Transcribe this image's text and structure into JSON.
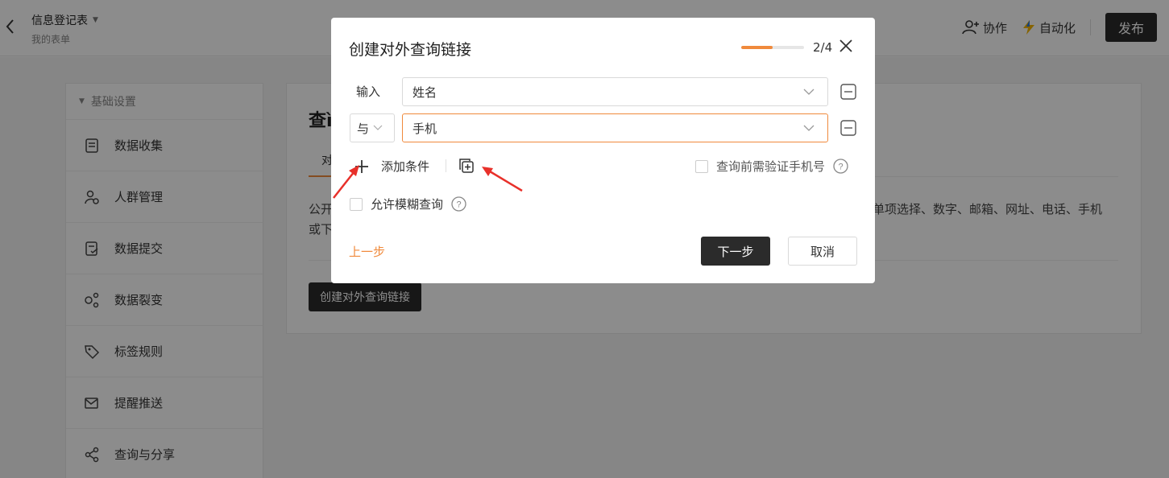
{
  "header": {
    "doc_title": "信息登记表",
    "doc_subtitle": "我的表单",
    "collab_label": "协作",
    "automation_label": "自动化",
    "publish_label": "发布"
  },
  "sidebar": {
    "group_label": "基础设置",
    "items": [
      {
        "label": "数据收集",
        "icon": "document-icon"
      },
      {
        "label": "人群管理",
        "icon": "user-group-icon"
      },
      {
        "label": "数据提交",
        "icon": "submit-icon"
      },
      {
        "label": "数据裂变",
        "icon": "fission-icon"
      },
      {
        "label": "标签规则",
        "icon": "tag-icon"
      },
      {
        "label": "提醒推送",
        "icon": "send-icon"
      },
      {
        "label": "查询与分享",
        "icon": "share-icon"
      }
    ]
  },
  "main": {
    "title_partial": "查ì",
    "tab_partial": "对",
    "desc_left_1": "公开",
    "desc_left_2": "或下",
    "desc_right": "单项选择、数字、邮箱、网址、电话、手机",
    "create_button": "创建对外查询链接"
  },
  "modal": {
    "title": "创建对外查询链接",
    "progress_fraction": 0.5,
    "step_text": "2/4",
    "input_label": "输入",
    "field_1_value": "姓名",
    "logic_value": "与",
    "field_2_value": "手机",
    "add_condition_label": "添加条件",
    "verify_phone_label": "查询前需验证手机号",
    "verify_phone_checked": false,
    "fuzzy_query_label": "允许模糊查询",
    "fuzzy_query_checked": false,
    "prev_label": "上一步",
    "next_label": "下一步",
    "cancel_label": "取消"
  },
  "colors": {
    "accent": "#f08a3c",
    "dark_button": "#2b2b2b",
    "annotation_arrow": "#e8302a"
  }
}
